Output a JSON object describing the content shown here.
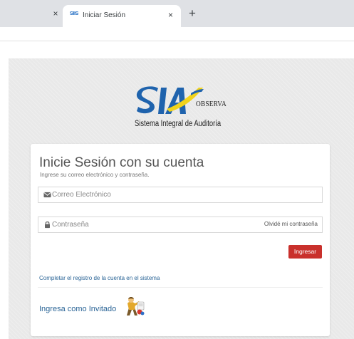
{
  "browser": {
    "active_tab": {
      "favicon_text": "SIIS",
      "title": "Iniciar Sesión"
    },
    "close_glyph": "×",
    "new_tab_glyph": "+"
  },
  "logo": {
    "subtitle": "Sistema Integral de Auditoría",
    "observa": "OBSERVA"
  },
  "login": {
    "title": "Inicie Sesión con su cuenta",
    "subtitle": "Ingrese su correo electrónico y contraseña.",
    "email_placeholder": "Correo Electrónico",
    "password_placeholder": "Contraseña",
    "forgot_label": "Olvidé mi contraseña",
    "submit_label": "Ingresar",
    "register_label": "Completar el registro de la cuenta en el sistema",
    "guest_label": "Ingresa como Invitado"
  },
  "colors": {
    "submit_button": "#c9302c",
    "link": "#2a6496",
    "logo_blue": "#1f63ad",
    "logo_yellow": "#f2d31b"
  },
  "icons": {
    "email": "envelope-icon",
    "password": "lock-icon",
    "guest": "guest-user-icon"
  }
}
